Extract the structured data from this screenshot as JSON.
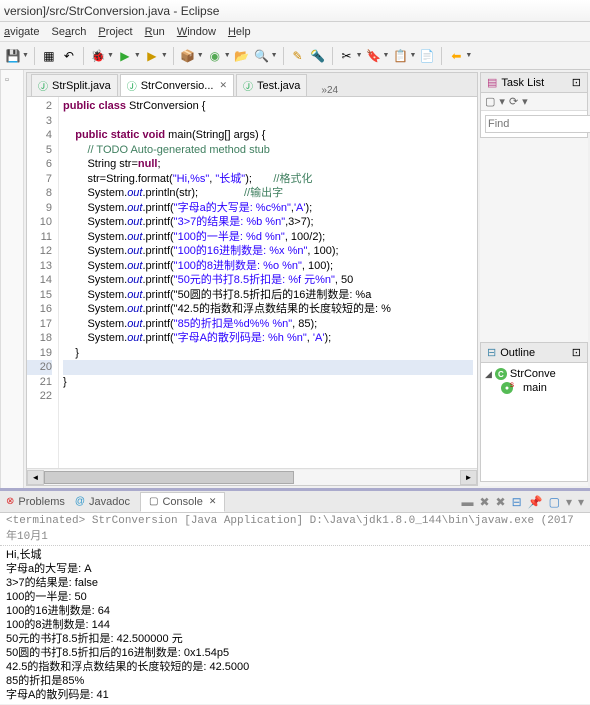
{
  "title": "version]/src/StrConversion.java - Eclipse",
  "menu": [
    "avigate",
    "Search",
    "Project",
    "Run",
    "Window",
    "Help"
  ],
  "tabs": [
    {
      "label": "StrSplit.java",
      "active": false
    },
    {
      "label": "StrConversio...",
      "active": true
    },
    {
      "label": "Test.java",
      "active": false
    }
  ],
  "breadcrumb": "»24",
  "lines": [
    {
      "n": 2,
      "raw": "public class StrConversion {"
    },
    {
      "n": 3,
      "raw": ""
    },
    {
      "n": 4,
      "raw": "    public static void main(String[] args) {"
    },
    {
      "n": 5,
      "raw": "        // TODO Auto-generated method stub"
    },
    {
      "n": 6,
      "raw": "        String str=null;"
    },
    {
      "n": 7,
      "raw": "        str=String.format(\"Hi,%s\", \"长城\");       //格式化"
    },
    {
      "n": 8,
      "raw": "        System.out.println(str);               //输出字"
    },
    {
      "n": 9,
      "raw": "        System.out.printf(\"字母a的大写是: %c%n\",'A');"
    },
    {
      "n": 10,
      "raw": "        System.out.printf(\"3>7的结果是: %b %n\",3>7);"
    },
    {
      "n": 11,
      "raw": "        System.out.printf(\"100的一半是: %d %n\", 100/2);"
    },
    {
      "n": 12,
      "raw": "        System.out.printf(\"100的16进制数是: %x %n\", 100);"
    },
    {
      "n": 13,
      "raw": "        System.out.printf(\"100的8进制数是: %o %n\", 100);"
    },
    {
      "n": 14,
      "raw": "        System.out.printf(\"50元的书打8.5折扣是: %f 元%n\", 50"
    },
    {
      "n": 15,
      "raw": "        System.out.printf(\"50圆的书打8.5折扣后的16进制数是: %a"
    },
    {
      "n": 16,
      "raw": "        System.out.printf(\"42.5的指数和浮点数结果的长度较短的是: %"
    },
    {
      "n": 17,
      "raw": "        System.out.printf(\"85的折扣是%d%% %n\", 85);"
    },
    {
      "n": 18,
      "raw": "        System.out.printf(\"字母A的散列码是: %h %n\", 'A');"
    },
    {
      "n": 19,
      "raw": "    }"
    },
    {
      "n": 20,
      "raw": ""
    },
    {
      "n": 21,
      "raw": "}"
    },
    {
      "n": 22,
      "raw": ""
    }
  ],
  "tasklist_title": "Task List",
  "find_placeholder": "Find",
  "outline_title": "Outline",
  "outline": [
    {
      "label": "StrConve",
      "indent": 1
    },
    {
      "label": "main",
      "indent": 2
    }
  ],
  "console_tabs": [
    {
      "label": "Problems",
      "icon": "⚠"
    },
    {
      "label": "Javadoc",
      "icon": "@"
    },
    {
      "label": "Console",
      "icon": "▢",
      "active": true
    }
  ],
  "console_header": "<terminated> StrConversion [Java Application] D:\\Java\\jdk1.8.0_144\\bin\\javaw.exe (2017年10月1",
  "console_output": [
    "Hi,长城",
    "字母a的大写是: A",
    "3>7的结果是: false",
    "100的一半是: 50",
    "100的16进制数是: 64",
    "100的8进制数是: 144",
    "50元的书打8.5折扣是: 42.500000 元",
    "50圆的书打8.5折扣后的16进制数是: 0x1.54p5",
    "42.5的指数和浮点数结果的长度较短的是: 42.5000",
    "85的折扣是85%",
    "字母A的散列码是: 41"
  ]
}
